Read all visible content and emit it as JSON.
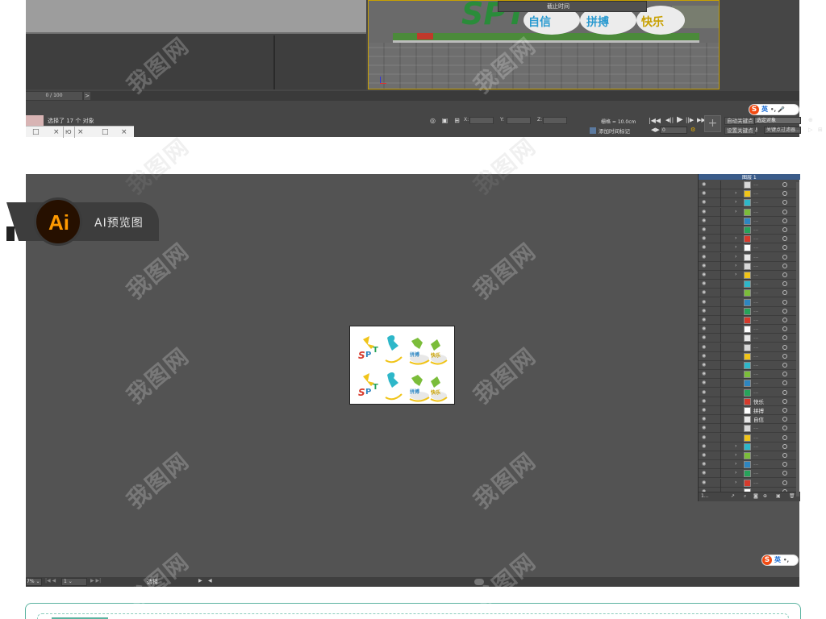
{
  "max": {
    "context_menu": "截止时间",
    "time_slider": "0 / 100",
    "time_arrow": ">",
    "status": "选择了 17 个 对象",
    "taskbar": {
      "tab1": "",
      "tab2": "Ю",
      "icons": [
        "□",
        "×",
        "□",
        "×"
      ]
    },
    "coords": {
      "x": "X:",
      "y": "Y:",
      "z": "Z:"
    },
    "grid": "栅格 = 10.0cm",
    "add_time_tag": "添加时间标记",
    "auto_key": "自动关键点",
    "set_key": "设置关键点",
    "key_filter_select": "选定对象",
    "key_filters": "关键点过滤器...",
    "frame_value": "0",
    "sign": {
      "spt": "SPT",
      "word1": "自信",
      "word2": "拼搏",
      "word3": "快乐"
    }
  },
  "ai": {
    "badge_icon": "Ai",
    "badge_label": "AI预览图",
    "status": {
      "zoom": "7%",
      "page": "1",
      "tool": "选择"
    },
    "layers": {
      "top_layer": "图层 1",
      "named_rows": [
        "快乐",
        "拼搏",
        "自信"
      ],
      "footer": "1..."
    },
    "artboard_words": [
      "拼搏",
      "快乐"
    ]
  },
  "ime": {
    "logo": "S",
    "lang": "英"
  },
  "watermark": "我图网",
  "colors": {
    "max_bg": "#464646",
    "ai_bg": "#535353",
    "ai_orange": "#ff9a00",
    "teal": "#5bb3a0",
    "sogou": "#f24a12"
  }
}
